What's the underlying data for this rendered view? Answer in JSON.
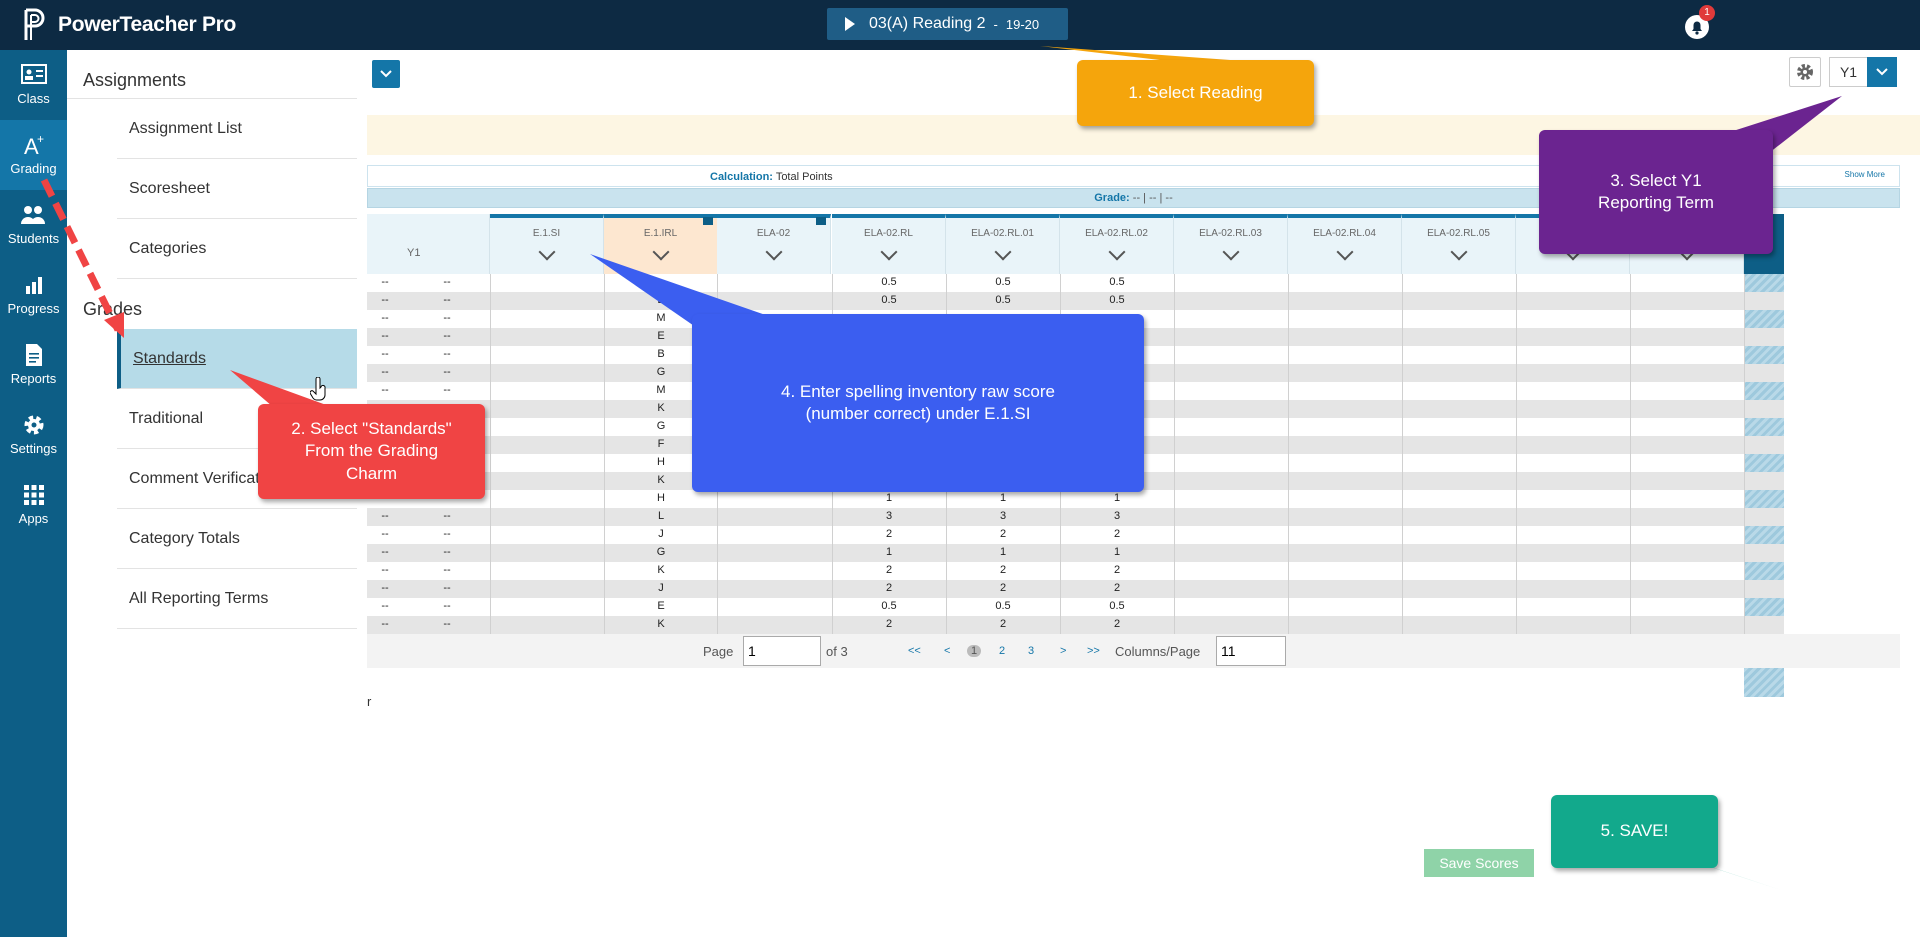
{
  "app": {
    "name": "PowerTeacher Pro"
  },
  "class_picker": {
    "label": "03(A) Reading 2",
    "sep": "-",
    "term": "19-20"
  },
  "notifications": {
    "count": "1"
  },
  "rail": [
    {
      "label": "Class",
      "icon": "class-icon"
    },
    {
      "label": "Grading",
      "icon": "grading-icon"
    },
    {
      "label": "Students",
      "icon": "students-icon"
    },
    {
      "label": "Progress",
      "icon": "progress-icon"
    },
    {
      "label": "Reports",
      "icon": "reports-icon"
    },
    {
      "label": "Settings",
      "icon": "settings-icon"
    },
    {
      "label": "Apps",
      "icon": "apps-icon"
    }
  ],
  "subnav": {
    "assignments_heading": "Assignments",
    "grades_heading": "Grades",
    "items": [
      "Assignment List",
      "Scoresheet",
      "Categories",
      "Standards",
      "Traditional",
      "Comment Verification",
      "Category Totals",
      "All Reporting Terms"
    ]
  },
  "toolbar": {
    "term": "Y1"
  },
  "calc": {
    "label": "Calculation:",
    "value": "Total Points",
    "show_more": "Show More"
  },
  "grade_bar": {
    "label": "Grade:",
    "v1": "--",
    "v2": "--",
    "v3": "--"
  },
  "grid": {
    "y1_label": "Y1",
    "columns": [
      "E.1.SI",
      "E.1.IRL",
      "ELA-02",
      "ELA-02.RL",
      "ELA-02.RL.01",
      "ELA-02.RL.02",
      "ELA-02.RL.03",
      "ELA-02.RL.04",
      "ELA-02.RL.05",
      "",
      ""
    ],
    "rows": [
      [
        "--",
        "--",
        "",
        "",
        "",
        "0.5",
        "0.5",
        "0.5"
      ],
      [
        "--",
        "--",
        "",
        "E",
        "",
        "0.5",
        "0.5",
        "0.5"
      ],
      [
        "--",
        "--",
        "",
        "M",
        "",
        "",
        "",
        ""
      ],
      [
        "--",
        "--",
        "",
        "E",
        "",
        "",
        "",
        ""
      ],
      [
        "--",
        "--",
        "",
        "B",
        "",
        "",
        "",
        ""
      ],
      [
        "--",
        "--",
        "",
        "G",
        "",
        "",
        "",
        ""
      ],
      [
        "--",
        "--",
        "",
        "M",
        "",
        "",
        "",
        ""
      ],
      [
        "--",
        "--",
        "",
        "K",
        "",
        "",
        "",
        ""
      ],
      [
        "--",
        "--",
        "",
        "G",
        "",
        "",
        "",
        ""
      ],
      [
        "--",
        "--",
        "",
        "F",
        "",
        "",
        "",
        ""
      ],
      [
        "--",
        "--",
        "",
        "H",
        "",
        "",
        "",
        ""
      ],
      [
        "--",
        "--",
        "",
        "K",
        "",
        "",
        "",
        ""
      ],
      [
        "--",
        "--",
        "",
        "H",
        "",
        "1",
        "1",
        "1"
      ],
      [
        "--",
        "--",
        "",
        "L",
        "",
        "3",
        "3",
        "3"
      ],
      [
        "--",
        "--",
        "",
        "J",
        "",
        "2",
        "2",
        "2"
      ],
      [
        "--",
        "--",
        "",
        "G",
        "",
        "1",
        "1",
        "1"
      ],
      [
        "--",
        "--",
        "",
        "K",
        "",
        "2",
        "2",
        "2"
      ],
      [
        "--",
        "--",
        "",
        "J",
        "",
        "2",
        "2",
        "2"
      ],
      [
        "--",
        "--",
        "",
        "E",
        "",
        "0.5",
        "0.5",
        "0.5"
      ],
      [
        "--",
        "--",
        "",
        "K",
        "",
        "2",
        "2",
        "2"
      ]
    ]
  },
  "pager": {
    "page_label": "Page",
    "page_value": "1",
    "of_label": "of 3",
    "first": "<<",
    "prev": "<",
    "p1": "1",
    "p2": "2",
    "p3": "3",
    "next": ">",
    "last": ">>",
    "cols_label": "Columns/Page",
    "cols_value": "11"
  },
  "stray_text": "r",
  "save_label": "Save Scores",
  "callouts": {
    "c1": "1.  Select Reading",
    "c2": "2.  Select \"Standards\" From the Grading Charm",
    "c3": "3.  Select Y1 Reporting Term",
    "c4": "4.  Enter spelling inventory raw score (number correct) under E.1.SI",
    "c5": "5.  SAVE!"
  },
  "colors": {
    "topbar": "#0d2a43",
    "rail": "#0d5e86",
    "accent": "#1476a8",
    "orange": "#f5a50c",
    "purple": "#6b2490",
    "red": "#f04444",
    "blue": "#3b5ef0",
    "green": "#12a98c"
  }
}
